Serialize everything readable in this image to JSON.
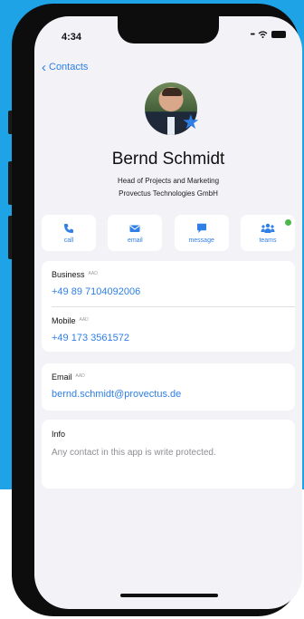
{
  "status_bar": {
    "time": "4:34"
  },
  "nav": {
    "back_label": "Contacts"
  },
  "contact": {
    "name": "Bernd Schmidt",
    "title": "Head of Projects and Marketing",
    "company": "Provectus Technologies GmbH",
    "favorite": true
  },
  "actions": [
    {
      "label": "call",
      "icon": "phone-icon"
    },
    {
      "label": "email",
      "icon": "mail-icon"
    },
    {
      "label": "message",
      "icon": "chat-icon"
    },
    {
      "label": "teams",
      "icon": "teams-icon",
      "presence_color": "#4cb84c"
    }
  ],
  "phones": [
    {
      "label": "Business",
      "source": "AAD",
      "value": "+49 89 7104092006"
    },
    {
      "label": "Mobile",
      "source": "AAD",
      "value": "+49 173 3561572"
    }
  ],
  "email": {
    "label": "Email",
    "source": "AAD",
    "value": "bernd.schmidt@provectus.de"
  },
  "info": {
    "label": "Info",
    "text": "Any contact in this app is write protected."
  },
  "colors": {
    "accent": "#2f7fe6",
    "background": "#1ea3e6",
    "presence": "#4cb84c"
  }
}
